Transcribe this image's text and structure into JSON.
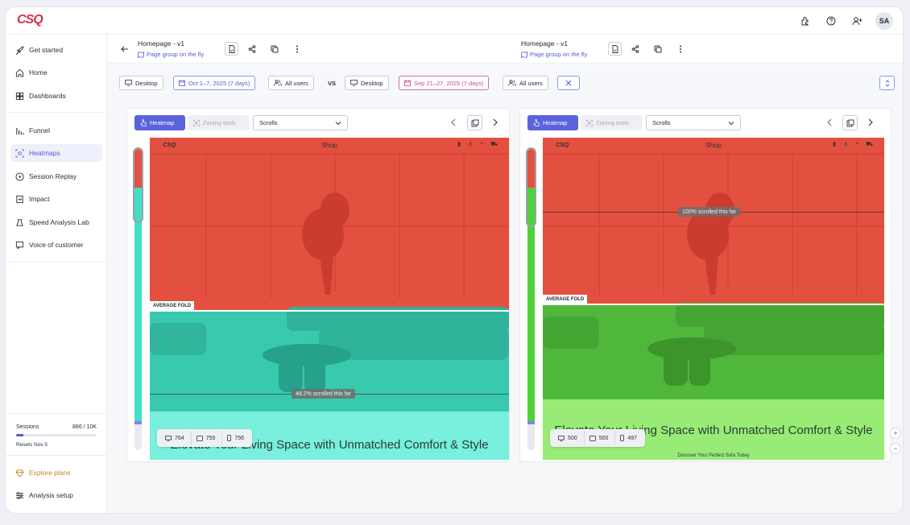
{
  "app": {
    "logo": "CSQ",
    "avatar": "SA"
  },
  "sidebar": {
    "items": [
      {
        "label": "Get started",
        "icon": "rocket-icon"
      },
      {
        "label": "Home",
        "icon": "home-icon"
      },
      {
        "label": "Dashboards",
        "icon": "dashboard-icon"
      },
      {
        "label": "Funnel",
        "icon": "funnel-icon"
      },
      {
        "label": "Heatmaps",
        "icon": "heatmap-icon"
      },
      {
        "label": "Session Replay",
        "icon": "play-icon"
      },
      {
        "label": "Impact",
        "icon": "impact-icon"
      },
      {
        "label": "Speed Analysis Lab",
        "icon": "speed-icon"
      },
      {
        "label": "Voice of customer",
        "icon": "voice-icon"
      }
    ],
    "sessions_label": "Sessions",
    "sessions_count": "886 / 10K",
    "sessions_progress": 0.0886,
    "resets": "Resets Nov 5",
    "explore": "Explore plans",
    "setup": "Analysis setup"
  },
  "left": {
    "title": "Homepage - v1",
    "subtitle": "Page group on the fly",
    "device": "Desktop",
    "date": "Oct 1–7, 2025 (7 days)",
    "users": "All users",
    "heatmap": "Heatmap",
    "zoning": "Zoning tools",
    "select": "Scrolls",
    "avg_fold": "AVERAGE FOLD",
    "scroll_label": "48.2% scrolled this far",
    "hero": "Elevate Your Living Space with Unmatched Comfort & Style",
    "counts": {
      "desktop": "764",
      "tablet": "755",
      "mobile": "756"
    }
  },
  "vs": "VS",
  "right": {
    "title": "Homepage - v1",
    "subtitle": "Page group on the fly",
    "device": "Desktop",
    "date": "Sep 21–27, 2025 (7 days)",
    "users": "All users",
    "heatmap": "Heatmap",
    "zoning": "Zoning tools",
    "select": "Scrolls",
    "avg_fold": "AVERAGE FOLD",
    "scroll_label": "100% scrolled this far",
    "hero": "Elevate Your Living Space with Unmatched Comfort & Style",
    "hero_sub": "Discover Your Perfect Sofa Today",
    "counts": {
      "desktop": "500",
      "tablet": "500",
      "mobile": "497"
    }
  },
  "site": {
    "logo": "CSQ",
    "nav": "Shop"
  },
  "colors": {
    "accent": "#5b63dc",
    "red": "#e4503f",
    "teal": "#3fe0c5",
    "green": "#5fdc48"
  }
}
